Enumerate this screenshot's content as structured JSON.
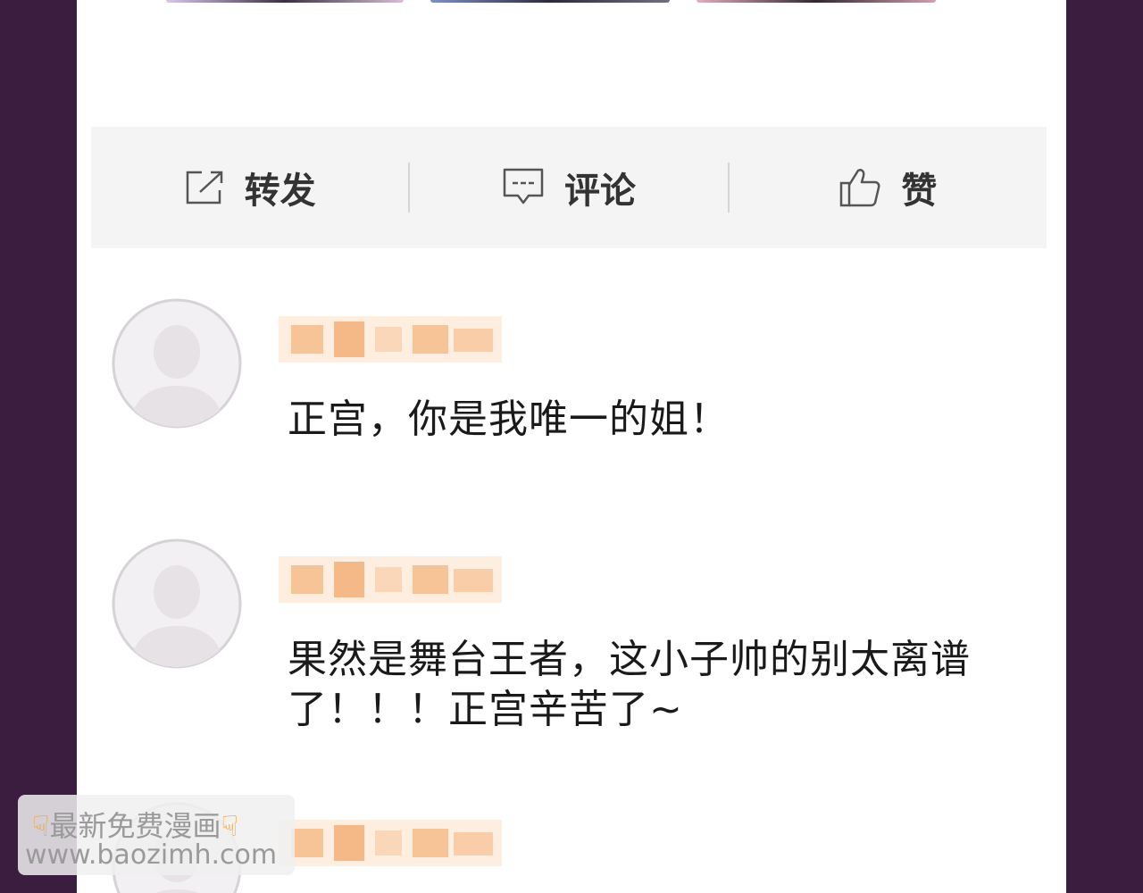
{
  "actions": {
    "repost": {
      "label": "转发",
      "icon": "share-icon"
    },
    "comment": {
      "label": "评论",
      "icon": "comment-icon"
    },
    "like": {
      "label": "赞",
      "icon": "thumbs-up-icon"
    }
  },
  "comments": [
    {
      "text": "正宫，你是我唯一的姐！",
      "avatar": "default-avatar-icon"
    },
    {
      "text": "果然是舞台王者，这小子帅的别太离谱了！！！正宫辛苦了~",
      "avatar": "default-avatar-icon"
    },
    {
      "text": "",
      "avatar": "default-avatar-icon"
    }
  ],
  "watermark": {
    "line1": "最新免费漫画",
    "line2": "www.baozimh.com",
    "icon": "pointing-down-hand-icon"
  },
  "colors": {
    "background": "#3b1d3f",
    "username_blur": "#f7c9a0",
    "action_bar": "#f4f4f4"
  }
}
